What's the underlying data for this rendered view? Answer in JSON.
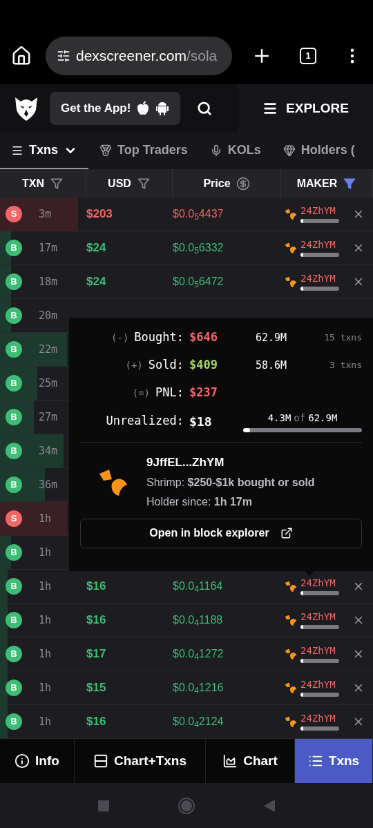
{
  "browser": {
    "url_host": "dexscreener.com",
    "url_path": "/sola",
    "tab_count": "1"
  },
  "header": {
    "app_button": "Get the App!",
    "explore_button": "EXPLORE"
  },
  "tabs": [
    {
      "label": "Txns",
      "selected": true
    },
    {
      "label": "Top Traders",
      "selected": false
    },
    {
      "label": "KOLs",
      "selected": false
    },
    {
      "label": "Holders (",
      "selected": false
    }
  ],
  "columns": [
    {
      "label": "TXN",
      "kind": "filter",
      "active": false
    },
    {
      "label": "USD",
      "kind": "filter",
      "active": false
    },
    {
      "label": "Price",
      "kind": "currency"
    },
    {
      "label": "MAKER",
      "kind": "filter",
      "active": true
    }
  ],
  "rows": [
    {
      "kind": "sell",
      "side": "S",
      "time": "3m",
      "usd": "$203",
      "price": "$0.0$_{5}$4437",
      "maker": "24ZhYM",
      "level": 0.21
    },
    {
      "kind": "buy",
      "side": "B",
      "time": "17m",
      "usd": "$24",
      "price": "$0.0$_{5}$6332",
      "maker": "24ZhYM",
      "level": 0.03
    },
    {
      "kind": "buy",
      "side": "B",
      "time": "18m",
      "usd": "$24",
      "price": "$0.0$_{5}$6472",
      "maker": "24ZhYM",
      "level": 0.03
    },
    {
      "kind": "buy",
      "side": "B",
      "time": "20m",
      "level": 0.03
    },
    {
      "kind": "buy",
      "side": "B",
      "time": "22m",
      "level": 0.18
    },
    {
      "kind": "buy",
      "side": "B",
      "time": "25m",
      "level": 0.1
    },
    {
      "kind": "buy",
      "side": "B",
      "time": "27m",
      "level": 0.09
    },
    {
      "kind": "buy",
      "side": "B",
      "time": "34m",
      "level": 0.17
    },
    {
      "kind": "buy",
      "side": "B",
      "time": "36m",
      "level": 0.12
    },
    {
      "kind": "sell",
      "side": "S",
      "time": "1h",
      "level": 0.18
    },
    {
      "kind": "buy",
      "side": "B",
      "time": "1h",
      "level": 0.03
    },
    {
      "kind": "buy",
      "side": "B",
      "time": "1h",
      "usd": "$16",
      "price": "$0.0$_{4}$1164",
      "maker": "24ZhYM",
      "level": 0.02
    },
    {
      "kind": "buy",
      "side": "B",
      "time": "1h",
      "usd": "$16",
      "price": "$0.0$_{4}$1188",
      "maker": "24ZhYM",
      "level": 0.02
    },
    {
      "kind": "buy",
      "side": "B",
      "time": "1h",
      "usd": "$17",
      "price": "$0.0$_{4}$1272",
      "maker": "24ZhYM",
      "level": 0.02
    },
    {
      "kind": "buy",
      "side": "B",
      "time": "1h",
      "usd": "$15",
      "price": "$0.0$_{4}$1216",
      "maker": "24ZhYM",
      "level": 0.02
    },
    {
      "kind": "buy",
      "side": "B",
      "time": "1h",
      "usd": "$16",
      "price": "$0.0$_{4}$2124",
      "maker": "24ZhYM",
      "level": 0.02
    }
  ],
  "popup": {
    "lines": [
      {
        "kind": "loss",
        "sign": "(-)",
        "label": "Bought:",
        "usd": "$646",
        "tokens": "62.9M",
        "txns": "15 txns"
      },
      {
        "kind": "gain",
        "sign": "(+)",
        "label": "Sold:",
        "usd": "$409",
        "tokens": "58.6M",
        "txns": "3 txns"
      },
      {
        "kind": "loss",
        "sign": "(=)",
        "label": "PNL:",
        "usd": "$237"
      }
    ],
    "unrealized": {
      "label": "Unrealized:",
      "usd": "$18",
      "held": "4.3M",
      "of": "of",
      "total": "62.9M",
      "level": 0.06
    },
    "wallet": "9JffEL...ZhYM",
    "tier": "Shrimp: **$250-$1k bought or sold**",
    "holder_since": "Holder since: **1h 17m**",
    "explorer_button": "Open in block explorer"
  },
  "bottom_nav": [
    {
      "label": "Info",
      "selected": false
    },
    {
      "label": "Chart+Txns",
      "selected": false
    },
    {
      "label": "Chart",
      "selected": false
    },
    {
      "label": "Txns",
      "selected": true
    }
  ]
}
